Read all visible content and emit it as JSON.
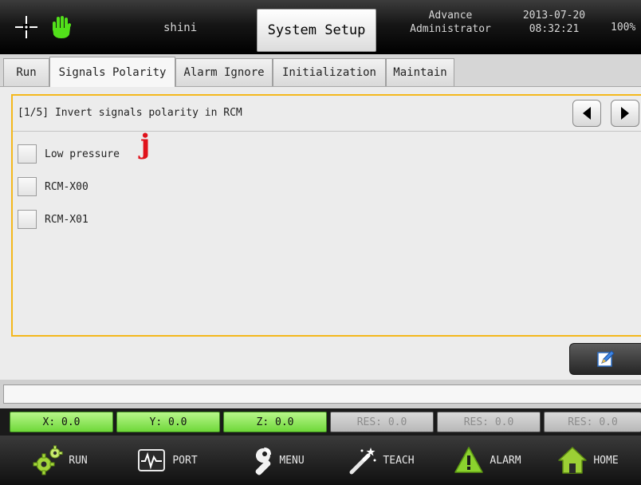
{
  "header": {
    "user": "shini",
    "title": "System Setup",
    "level_line1": "Advance",
    "level_line2": "Administrator",
    "date": "2013-07-20",
    "time": "08:32:21",
    "percent": "100%",
    "icons": [
      "crosshair-icon",
      "hand-icon"
    ]
  },
  "tabs": [
    {
      "label": "Run",
      "active": false
    },
    {
      "label": "Signals Polarity",
      "active": true
    },
    {
      "label": "Alarm Ignore",
      "active": false
    },
    {
      "label": "Initialization",
      "active": false
    },
    {
      "label": "Maintain",
      "active": false
    }
  ],
  "panel": {
    "title": "[1/5] Invert signals polarity in RCM",
    "signals": [
      {
        "label": "Low pressure",
        "checked": false
      },
      {
        "label": "RCM-X00",
        "checked": false
      },
      {
        "label": "RCM-X01",
        "checked": false
      }
    ],
    "marker": "j",
    "marker_color": "#e0121b",
    "border_color": "#f4b81c"
  },
  "message": "",
  "coords": [
    {
      "label": "X: 0.0",
      "active": true
    },
    {
      "label": "Y: 0.0",
      "active": true
    },
    {
      "label": "Z: 0.0",
      "active": true
    },
    {
      "label": "RES: 0.0",
      "active": false
    },
    {
      "label": "RES: 0.0",
      "active": false
    },
    {
      "label": "RES: 0.0",
      "active": false
    }
  ],
  "nav": [
    {
      "label": "RUN",
      "icon": "gears-icon"
    },
    {
      "label": "PORT",
      "icon": "waveform-icon"
    },
    {
      "label": "MENU",
      "icon": "wrench-icon"
    },
    {
      "label": "TEACH",
      "icon": "magic-wand-icon"
    },
    {
      "label": "ALARM",
      "icon": "warning-icon"
    },
    {
      "label": "HOME",
      "icon": "house-icon"
    }
  ],
  "colors": {
    "active_coord": "#7be245",
    "inactive_coord": "#c8c8c8",
    "header_bg": "#000000"
  }
}
